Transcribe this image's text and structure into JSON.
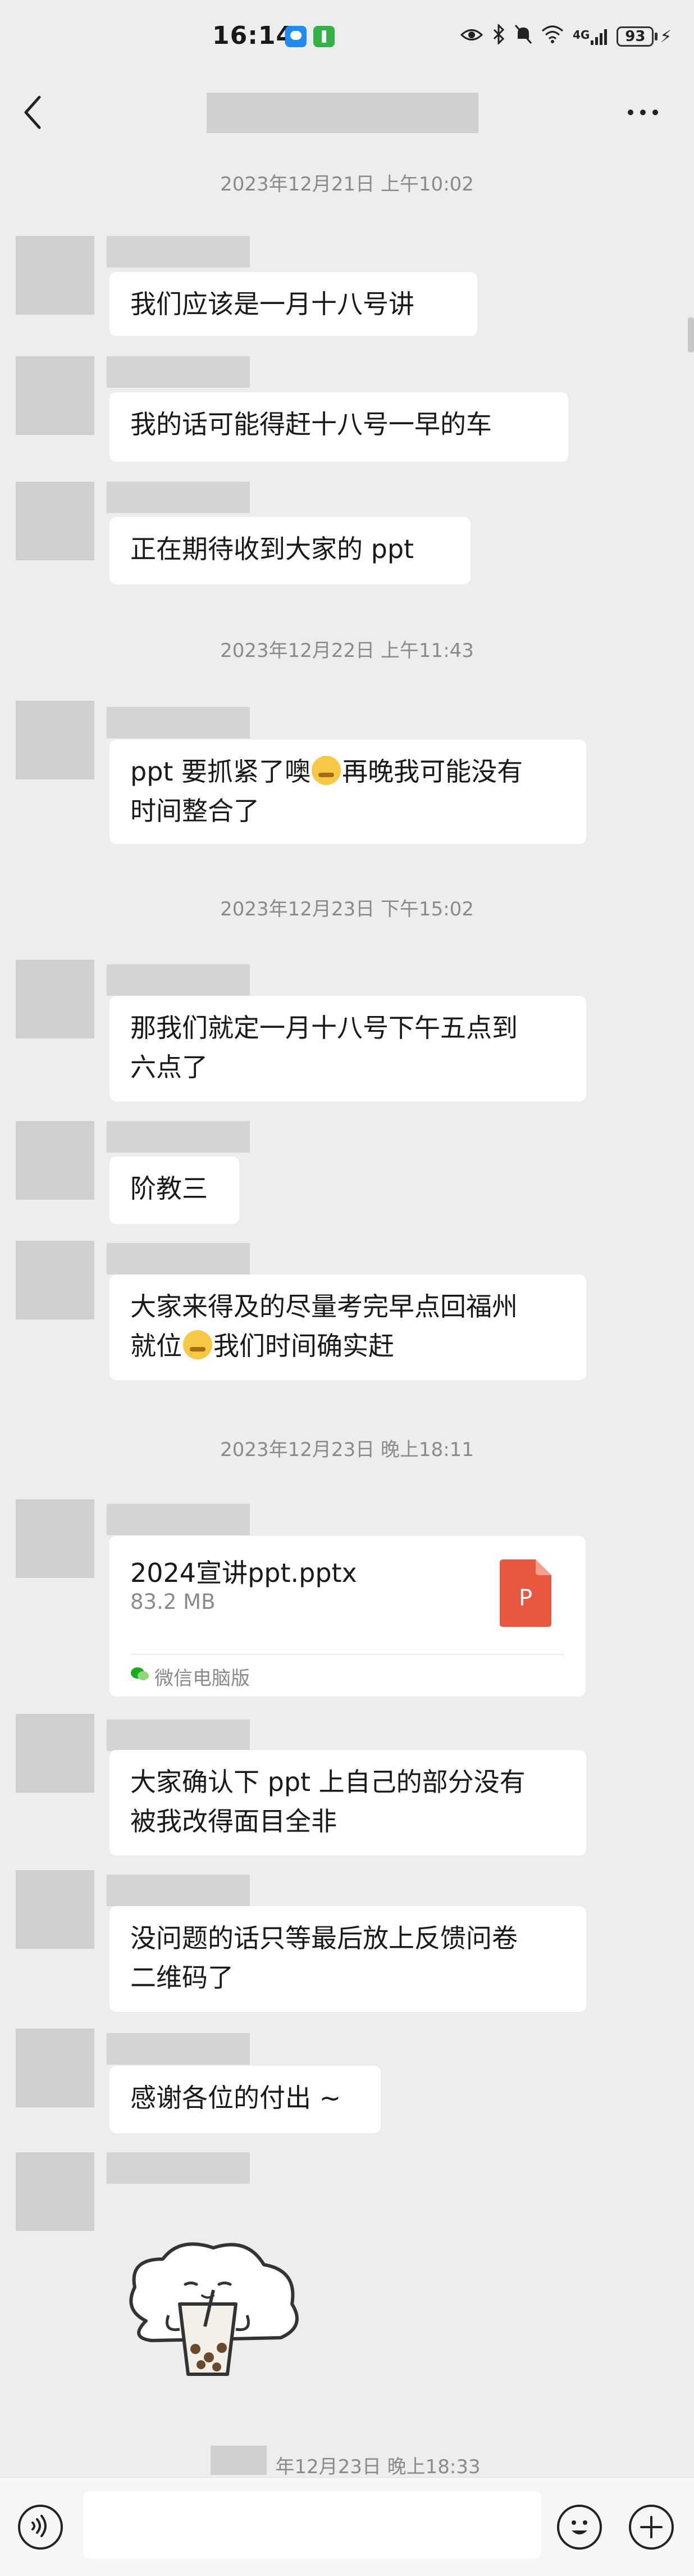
{
  "status_bar": {
    "time": "16:14",
    "network": "4G",
    "battery": "93",
    "icons": [
      "qq-notification-icon",
      "app-notification-icon",
      "eye-icon",
      "bluetooth-icon",
      "mute-icon",
      "wifi-icon",
      "signal-icon",
      "battery-icon",
      "charging-icon"
    ]
  },
  "nav": {
    "back_icon": "chevron-left-icon",
    "more_icon": "more-dots-icon"
  },
  "timestamps": {
    "t1": "2023年12月21日 上午10:02",
    "t2": "2023年12月22日 上午11:43",
    "t3": "2023年12月23日 下午15:02",
    "t4": "2023年12月23日 晚上18:11",
    "t5": "年12月23日 晚上18:33"
  },
  "messages": {
    "m1": "我们应该是一月十八号讲",
    "m2": "我的话可能得赶十八号一早的车",
    "m3": "正在期待收到大家的 ppt",
    "m4_a": "ppt 要抓紧了噢",
    "m4_b": "再晚我可能没有",
    "m4_c": "时间整合了",
    "m5_a": "那我们就定一月十八号下午五点到",
    "m5_b": "六点了",
    "m6": "阶教三",
    "m7_a": "大家来得及的尽量考完早点回福州",
    "m7_b": "就位",
    "m7_c": "我们时间确实赶",
    "m9_a": "大家确认下 ppt 上自己的部分没有",
    "m9_b": "被我改得面目全非",
    "m10_a": "没问题的话只等最后放上反馈问卷",
    "m10_b": "二维码了",
    "m11": "感谢各位的付出 ~"
  },
  "file": {
    "name": "2024宣讲ppt.pptx",
    "size": "83.2 MB",
    "source": "微信电脑版",
    "icon_letter": "P",
    "icon_color": "#e8573e"
  },
  "input_bar": {
    "placeholder": ""
  }
}
